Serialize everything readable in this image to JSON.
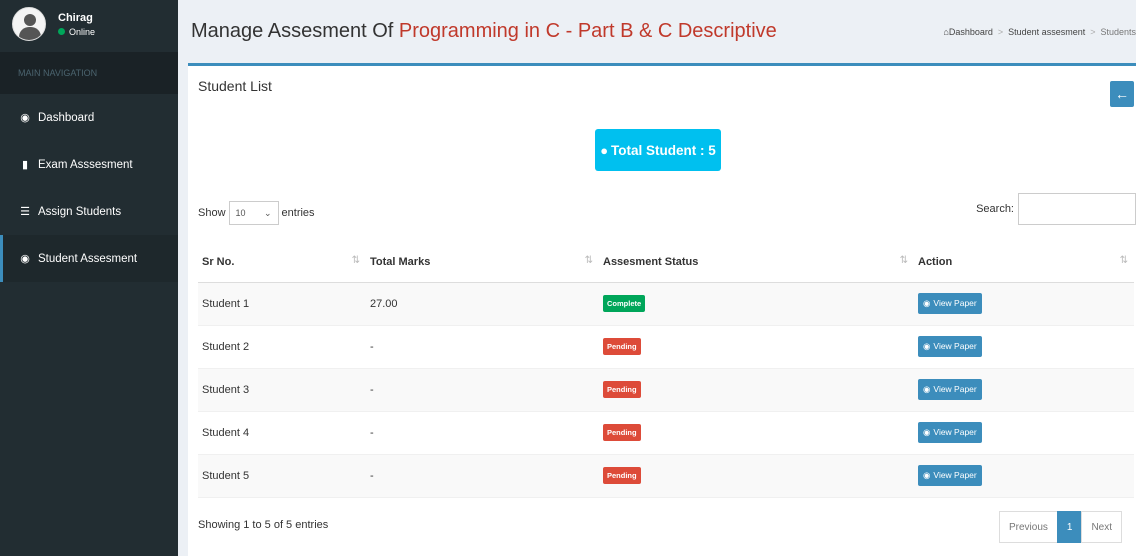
{
  "user": {
    "name": "Chirag",
    "status": "Online"
  },
  "sidebar": {
    "header": "MAIN NAVIGATION",
    "items": [
      {
        "label": "Dashboard",
        "icon": "dashboard-icon"
      },
      {
        "label": "Exam Asssesment",
        "icon": "file-icon"
      },
      {
        "label": "Assign Students",
        "icon": "list-icon"
      },
      {
        "label": "Student Assesment",
        "icon": "eye-icon",
        "active": true
      }
    ]
  },
  "header": {
    "title_prefix": "Manage Assesment Of",
    "title_subject": "Programming in C - Part B & C Descriptive",
    "breadcrumb": [
      "Dashboard",
      "Student assesment",
      "Students"
    ]
  },
  "box": {
    "title": "Student List",
    "total_label": "Total Student : 5",
    "show": "Show",
    "entries_value": "10",
    "entries": "entries",
    "search_label": "Search:",
    "columns": [
      "Sr No.",
      "Total Marks",
      "Assesment Status",
      "Action"
    ],
    "rows": [
      {
        "sr": "Student 1",
        "marks": "27.00",
        "status": "Complete",
        "action": "View Paper"
      },
      {
        "sr": "Student 2",
        "marks": "-",
        "status": "Pending",
        "action": "View Paper"
      },
      {
        "sr": "Student 3",
        "marks": "-",
        "status": "Pending",
        "action": "View Paper"
      },
      {
        "sr": "Student 4",
        "marks": "-",
        "status": "Pending",
        "action": "View Paper"
      },
      {
        "sr": "Student 5",
        "marks": "-",
        "status": "Pending",
        "action": "View Paper"
      }
    ],
    "showing": "Showing 1 to 5 of 5 entries",
    "pager": {
      "previous": "Previous",
      "page": "1",
      "next": "Next"
    }
  },
  "colors": {
    "sidebar_bg": "#222d32",
    "accent": "#3c8dbc",
    "info": "#00c0ef",
    "complete": "#00a65a",
    "pending": "#dd4b39",
    "subject": "#c0392b"
  }
}
